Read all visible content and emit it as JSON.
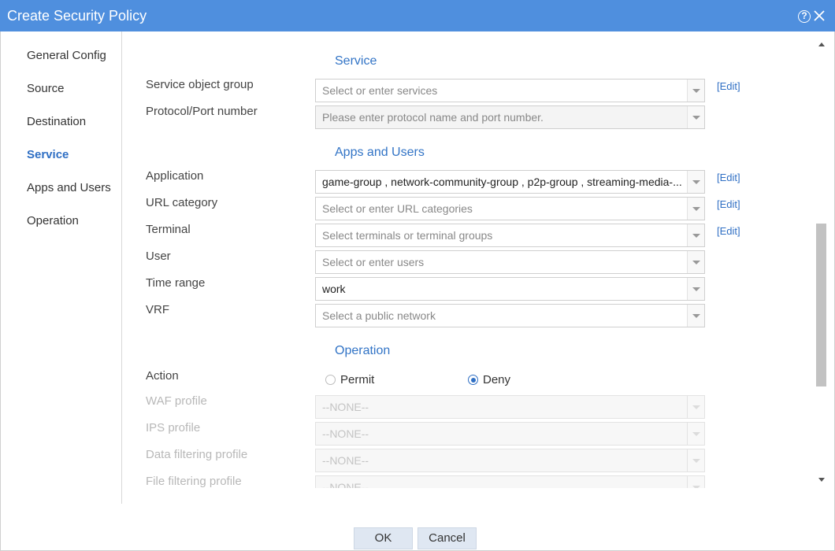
{
  "window": {
    "title": "Create Security Policy"
  },
  "sidebar": {
    "items": [
      {
        "label": "General Config",
        "active": false
      },
      {
        "label": "Source",
        "active": false
      },
      {
        "label": "Destination",
        "active": false
      },
      {
        "label": "Service",
        "active": true
      },
      {
        "label": "Apps and Users",
        "active": false
      },
      {
        "label": "Operation",
        "active": false
      }
    ]
  },
  "service": {
    "title": "Service",
    "service_object_group": {
      "label": "Service object group",
      "placeholder": "Select or enter services",
      "edit": "[Edit]"
    },
    "protocol_port": {
      "label": "Protocol/Port number",
      "placeholder": "Please enter protocol name and port number."
    }
  },
  "apps_users": {
    "title": "Apps and Users",
    "application": {
      "label": "Application",
      "value": "game-group , network-community-group , p2p-group , streaming-media-...",
      "edit": "[Edit]"
    },
    "url_category": {
      "label": "URL category",
      "placeholder": "Select or enter URL categories",
      "edit": "[Edit]"
    },
    "terminal": {
      "label": "Terminal",
      "placeholder": "Select terminals or terminal groups",
      "edit": "[Edit]"
    },
    "user": {
      "label": "User",
      "placeholder": "Select or enter users"
    },
    "time_range": {
      "label": "Time range",
      "value": "work"
    },
    "vrf": {
      "label": "VRF",
      "placeholder": "Select a public network"
    }
  },
  "operation": {
    "title": "Operation",
    "action": {
      "label": "Action",
      "options": [
        "Permit",
        "Deny"
      ],
      "selected": "Deny"
    },
    "waf_profile": {
      "label": "WAF profile",
      "value": "--NONE--"
    },
    "ips_profile": {
      "label": "IPS profile",
      "value": "--NONE--"
    },
    "data_filtering_profile": {
      "label": "Data filtering profile",
      "value": "--NONE--"
    },
    "file_filtering_profile": {
      "label": "File filtering profile",
      "value": "--NONE--"
    }
  },
  "footer": {
    "ok_label": "OK",
    "cancel_label": "Cancel"
  },
  "icons": {
    "help": "help-icon",
    "close": "close-icon"
  },
  "colors": {
    "titlebar": "#4f8fde",
    "accent": "#2f6fc4"
  }
}
